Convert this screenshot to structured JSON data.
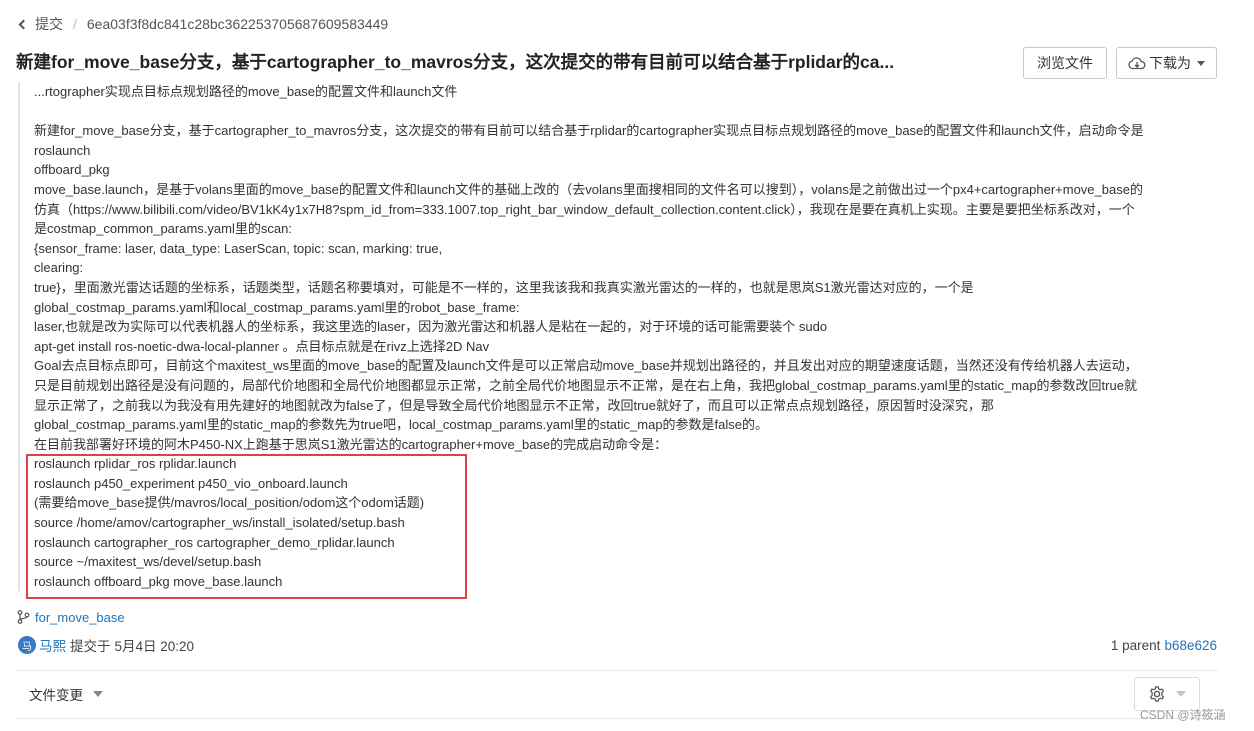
{
  "breadcrumb": {
    "back_label": "提交",
    "commit_hash": "6ea03f3f8dc841c28bc362253705687609583449"
  },
  "title": "新建for_move_base分支，基于cartographer_to_mavros分支，这次提交的带有目前可以结合基于rplidar的ca...",
  "buttons": {
    "browse_files": "浏览文件",
    "download_as": "下载为"
  },
  "message_lines": [
    "...rtographer实现点目标点规划路径的move_base的配置文件和launch文件",
    "",
    "新建for_move_base分支，基于cartographer_to_mavros分支，这次提交的带有目前可以结合基于rplidar的cartographer实现点目标点规划路径的move_base的配置文件和launch文件，启动命令是",
    "roslaunch",
    "offboard_pkg",
    "move_base.launch，是基于volans里面的move_base的配置文件和launch文件的基础上改的（去volans里面搜相同的文件名可以搜到），volans是之前做出过一个px4+cartographer+move_base的",
    "仿真（https://www.bilibili.com/video/BV1kK4y1x7H8?spm_id_from=333.1007.top_right_bar_window_default_collection.content.click），我现在是要在真机上实现。主要是要把坐标系改对，一个",
    "是costmap_common_params.yaml里的scan:",
    "{sensor_frame: laser, data_type: LaserScan, topic: scan, marking: true,",
    "clearing:",
    "true}，里面激光雷达话题的坐标系，话题类型，话题名称要填对，可能是不一样的，这里我该我和我真实激光雷达的一样的，也就是思岚S1激光雷达对应的，一个是",
    "global_costmap_params.yaml和local_costmap_params.yaml里的robot_base_frame:",
    "laser,也就是改为实际可以代表机器人的坐标系，我这里选的laser，因为激光雷达和机器人是粘在一起的，对于环境的话可能需要装个  sudo",
    "apt-get install ros-noetic-dwa-local-planner  。点目标点就是在rivz上选择2D Nav",
    "Goal去点目标点即可，目前这个maxitest_ws里面的move_base的配置及launch文件是可以正常启动move_base并规划出路径的，并且发出对应的期望速度话题，当然还没有传给机器人去运动，",
    "只是目前规划出路径是没有问题的，局部代价地图和全局代价地图都显示正常，之前全局代价地图显示不正常，是在右上角，我把global_costmap_params.yaml里的static_map的参数改回true就",
    "显示正常了，之前我以为我没有用先建好的地图就改为false了，但是导致全局代价地图显示不正常，改回true就好了，而且可以正常点点规划路径，原因暂时没深究，那",
    "global_costmap_params.yaml里的static_map的参数先为true吧，local_costmap_params.yaml里的static_map的参数是false的。",
    "在目前我部署好环境的阿木P450-NX上跑基于思岚S1激光雷达的cartographer+move_base的完成启动命令是：",
    "roslaunch rplidar_ros rplidar.launch",
    "roslaunch p450_experiment p450_vio_onboard.launch",
    "(需要给move_base提供/mavros/local_position/odom这个odom话题)",
    "source /home/amov/cartographer_ws/install_isolated/setup.bash",
    "roslaunch cartographer_ros cartographer_demo_rplidar.launch",
    "source ~/maxitest_ws/devel/setup.bash",
    "roslaunch offboard_pkg move_base.launch"
  ],
  "branch": "for_move_base",
  "author": {
    "avatar_initial": "马",
    "name": "马熙",
    "action": "提交于",
    "time": "5月4日 20:20"
  },
  "parent": {
    "label": "1 parent",
    "hash": "b68e626"
  },
  "file_changes_label": "文件变更",
  "watermark": "CSDN @诗筱涵",
  "colors": {
    "link": "#1f73b7",
    "highlight_box": "#e0403f",
    "avatar": "#3b78c4"
  },
  "icons": [
    "chevron-left-icon",
    "cloud-download-icon",
    "caret-down-icon",
    "branch-icon",
    "gear-icon"
  ]
}
